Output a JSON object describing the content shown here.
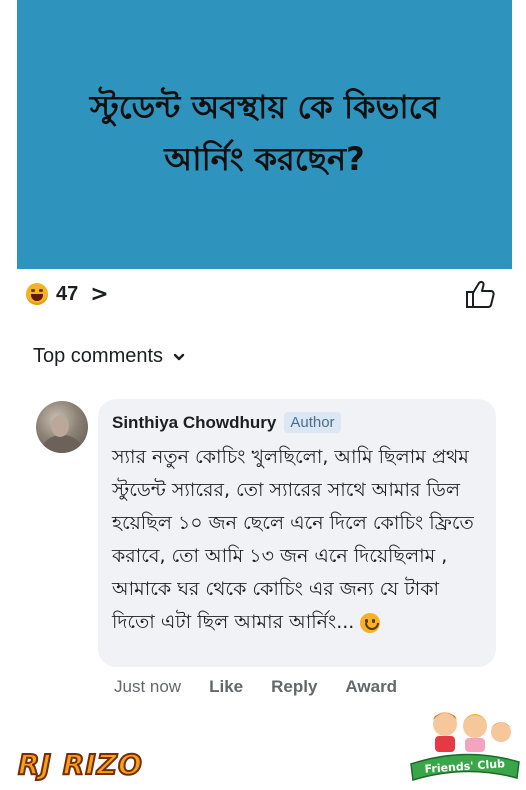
{
  "post": {
    "title": "স্টুডেন্ট অবস্থায় কে কিভাবে আর্নিং করছেন?"
  },
  "reactions": {
    "count": "47",
    "emoji": "haha-face-icon"
  },
  "section": {
    "label": "Top comments"
  },
  "comment": {
    "author": "Sinthiya Chowdhury",
    "badge": "Author",
    "text": "স্যার নতুন কোচিং খুলছিলো, আমি ছিলাম প্রথম স্টুডেন্ট স্যারের, তো স্যারের সাথে আমার ডিল হয়েছিল ১০ জন ছেলে এনে দিলে কোচিং ফ্রিতে করাবে, তো আমি ১৩ জন এনে দিয়েছিলাম , আমাকে ঘর থেকে কোচিং এর জন্য যে টাকা দিতো এটা ছিল আমার আর্নিং...",
    "actions": {
      "time": "Just now",
      "like": "Like",
      "reply": "Reply",
      "award": "Award"
    }
  },
  "watermarks": {
    "left": "RJ RIZO",
    "right": "Friends' Club"
  },
  "colors": {
    "banner": "#2e93bd",
    "bubble": "#f0f2f5",
    "secondary_text": "#65676b"
  }
}
